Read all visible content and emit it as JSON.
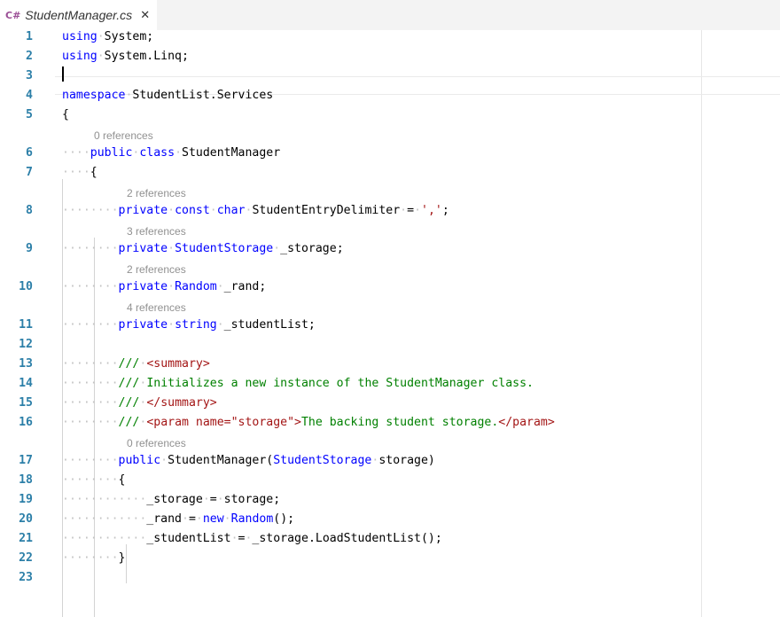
{
  "tab": {
    "icon": "C#",
    "title": "StudentManager.cs",
    "close": "✕"
  },
  "editor": {
    "line_numbers": [
      "1",
      "2",
      "3",
      "4",
      "5",
      "6",
      "7",
      "8",
      "9",
      "10",
      "11",
      "12",
      "13",
      "14",
      "15",
      "16",
      "17",
      "18",
      "19",
      "20",
      "21",
      "22",
      "23"
    ],
    "references": {
      "r6": "0 references",
      "r8": "2 references",
      "r9": "3 references",
      "r10": "2 references",
      "r11": "4 references",
      "r17": "0 references"
    },
    "tokens": {
      "using": "using",
      "system": "System;",
      "system_linq": "System.Linq;",
      "namespace": "namespace",
      "ns_name": "StudentList.Services",
      "lbrace": "{",
      "rbrace": "}",
      "public": "public",
      "class": "class",
      "class_name": "StudentManager",
      "private": "private",
      "const": "const",
      "char": "char",
      "delim_name": "StudentEntryDelimiter",
      "eq": "=",
      "comma_lit": "','",
      "semi": ";",
      "storage_type": "StudentStorage",
      "storage_field": "_storage;",
      "random_type": "Random",
      "rand_field": "_rand;",
      "string_type": "string",
      "list_field": "_studentList;",
      "doc": "///",
      "summary_open": "<summary>",
      "summary_text": "Initializes a new instance of the StudentManager class.",
      "summary_close": "</summary>",
      "param_open": "<param name=\"storage\">",
      "param_text": "The backing student storage.",
      "param_close": "</param>",
      "ctor_name": "StudentManager(",
      "ctor_param": "storage)",
      "storage_lhs": "_storage",
      "storage_rhs": "storage;",
      "rand_lhs": "_rand",
      "new": "new",
      "random_call": "Random",
      "call_suffix": "();",
      "list_lhs": "_studentList",
      "load_call": "_storage.LoadStudentList();"
    }
  }
}
